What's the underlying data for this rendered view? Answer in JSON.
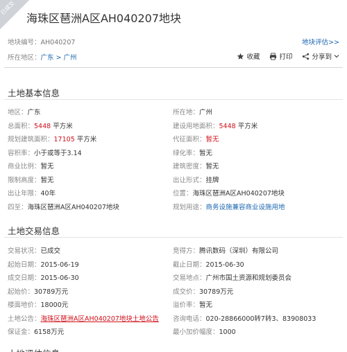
{
  "corner_badge": "已成交",
  "title": "海珠区琶洲A区AH040207地块",
  "land_code": {
    "label": "地块编号：",
    "value": "AH040207"
  },
  "location": {
    "label": "所在地区：",
    "value": "广东 > 广州"
  },
  "assess_link": "地块评估>>",
  "actions": {
    "favorite": {
      "label": "收藏",
      "icon": "star-icon"
    },
    "print": {
      "label": "打印",
      "icon": "printer-icon"
    },
    "share": {
      "label": "分享到",
      "icon": "share-icon"
    }
  },
  "basic_section": {
    "title": "土地基本信息",
    "rows": [
      {
        "l_label": "地区：",
        "l_value": "广东",
        "r_label": "所在地：",
        "r_value": "广州"
      },
      {
        "l_label": "总面积：",
        "l_value": "5448",
        "l_unit": "平方米",
        "r_label": "建设用地面积：",
        "r_value": "5448",
        "r_unit": "平方米"
      },
      {
        "l_label": "规划建筑面积：",
        "l_value": "17105",
        "l_unit": "平方米",
        "r_label": "代征面积：",
        "r_value": "暂无"
      },
      {
        "l_label": "容积率：",
        "l_value": "小于或等于3.14",
        "r_label": "绿化率：",
        "r_value": "暂无"
      },
      {
        "l_label": "商业比例：",
        "l_value": "暂无",
        "r_label": "建筑密度：",
        "r_value": "暂无"
      },
      {
        "l_label": "限制高度：",
        "l_value": "暂无",
        "r_label": "出让形式：",
        "r_value": "挂牌"
      },
      {
        "l_label": "出让年限：",
        "l_value": "40年",
        "r_label": "位置：",
        "r_value": "海珠区琶洲A区AH040207地块"
      },
      {
        "l_label": "四至：",
        "l_value": "海珠区琶洲A区AH040207地块",
        "r_label": "规划用途：",
        "r_value": "商务设施兼容商业设施用地"
      }
    ]
  },
  "trade_section": {
    "title": "土地交易信息",
    "rows": [
      {
        "l_label": "交易状况：",
        "l_value": "已成交",
        "r_label": "竞得方：",
        "r_value": "腾讯数码（深圳）有限公司"
      },
      {
        "l_label": "起始日期：",
        "l_value": "2015-06-19",
        "r_label": "截止日期：",
        "r_value": "2015-06-30"
      },
      {
        "l_label": "成交日期：",
        "l_value": "2015-06-30",
        "r_label": "交易地点：",
        "r_value": "广州市国土资源和规划委员会"
      },
      {
        "l_label": "起始价：",
        "l_value": "30789万元",
        "r_label": "成交价：",
        "r_value": "30789万元"
      },
      {
        "l_label": "楼面地价：",
        "l_value": "18000元",
        "r_label": "溢价率：",
        "r_value": "暂无"
      },
      {
        "l_label": "土地公告：",
        "l_value": "海珠区琶洲A区AH040207地块土地公告",
        "r_label": "咨询电话：",
        "r_value": "020-28866000转7转3、83908033"
      },
      {
        "l_label": "保证金：",
        "l_value": "6158万元",
        "r_label": "最小加价幅度：",
        "r_value": "1000"
      }
    ]
  },
  "partial_section_title": "土地评估信息",
  "colors": {
    "link": "#1b66b0",
    "highlight": "#d0111b",
    "badge": "#cfd3d8"
  }
}
